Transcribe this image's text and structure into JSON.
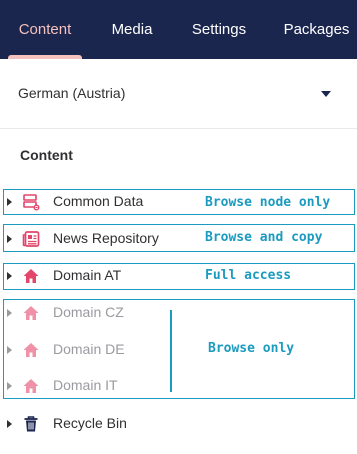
{
  "nav": {
    "tabs": [
      {
        "label": "Content",
        "active": true
      },
      {
        "label": "Media",
        "active": false
      },
      {
        "label": "Settings",
        "active": false
      },
      {
        "label": "Packages",
        "active": false
      }
    ]
  },
  "language_select": {
    "value": "German (Austria)"
  },
  "tree": {
    "title": "Content",
    "items": [
      {
        "label": "Common Data",
        "icon": "data-node-icon",
        "faded": false
      },
      {
        "label": "News Repository",
        "icon": "newspaper-icon",
        "faded": false
      },
      {
        "label": "Domain AT",
        "icon": "home-icon",
        "faded": false
      },
      {
        "label": "Domain CZ",
        "icon": "home-icon",
        "faded": true
      },
      {
        "label": "Domain DE",
        "icon": "home-icon",
        "faded": true
      },
      {
        "label": "Domain IT",
        "icon": "home-icon",
        "faded": true
      },
      {
        "label": "Recycle Bin",
        "icon": "trash-icon",
        "faded": false
      }
    ]
  },
  "annotations": {
    "browse_node_only": "Browse node only",
    "browse_and_copy": "Browse and copy",
    "full_access": "Full access",
    "browse_only": "Browse only"
  },
  "colors": {
    "nav_bg": "#1b264f",
    "active_tab": "#f5c1bc",
    "node_pink": "#e2466b",
    "annotation": "#1a9bbf"
  }
}
